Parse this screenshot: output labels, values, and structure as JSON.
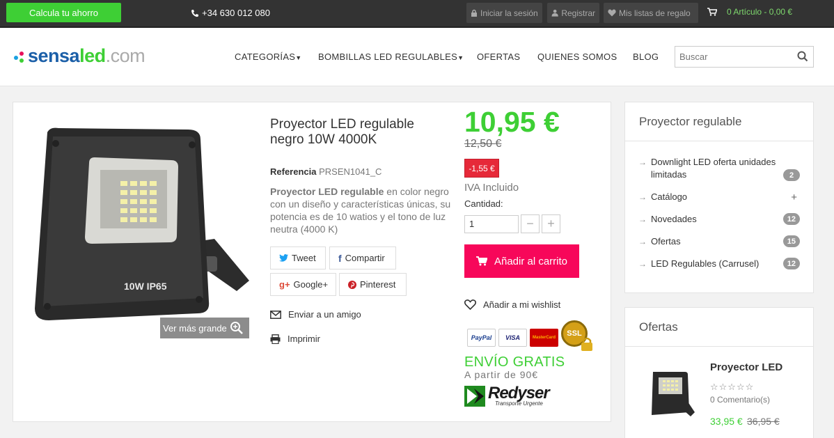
{
  "topbar": {
    "cta_label": "Calcula tu ahorro",
    "phone": "+34 630 012 080",
    "login": "Iniciar la sesión",
    "register": "Registrar",
    "gift_lists": "Mis listas de regalo",
    "cart_summary": "0 Artículo - 0,00 €"
  },
  "logo": {
    "sensa": "sensa",
    "led": "led",
    "dotcom": ".com"
  },
  "nav": {
    "items": [
      "CATEGORÍAS",
      "BOMBILLAS LED REGULABLES",
      "OFERTAS",
      "QUIENES SOMOS",
      "BLOG"
    ]
  },
  "search": {
    "placeholder": "Buscar"
  },
  "product": {
    "title": "Proyector LED regulable negro 10W 4000K",
    "reference_label": "Referencia",
    "reference": "PRSEN1041_C",
    "desc_bold": "Proyector LED regulable",
    "desc_rest": " en color negro con un diseño y características únicas, su potencia es de 10 watios y el tono de luz neutra (4000 K)",
    "zoom_label": "Ver más grande",
    "image_label": "10W  IP65",
    "share": {
      "tweet": "Tweet",
      "facebook": "Compartir",
      "google": "Google+",
      "pinterest": "Pinterest"
    },
    "send_friend": "Enviar a un amigo",
    "print": "Imprimir",
    "price": "10,95 €",
    "old_price": "12,50 €",
    "discount": "-1,55 €",
    "tax_note": "IVA Incluido",
    "quantity_label": "Cantidad:",
    "quantity_value": "1",
    "add_to_cart": "Añadir al carrito",
    "wishlist": "Añadir a mi wishlist",
    "payment": {
      "paypal": "PayPal",
      "visa": "VISA",
      "mastercard": "MasterCard",
      "ssl": "SSL"
    },
    "shipping_title": "ENVÍO GRATIS",
    "shipping_min": "A partir de 90€",
    "carrier_name": "Redyser",
    "carrier_sub": "Transporte Urgente"
  },
  "sidebar": {
    "category_title": "Proyector regulable",
    "items": [
      {
        "label": "Downlight LED oferta unidades limitadas",
        "count": "2"
      },
      {
        "label": "Catálogo",
        "count": "+"
      },
      {
        "label": "Novedades",
        "count": "12"
      },
      {
        "label": "Ofertas",
        "count": "15"
      },
      {
        "label": "LED Regulables (Carrusel)",
        "count": "12"
      }
    ],
    "offers_title": "Ofertas",
    "offer": {
      "name": "Proyector LED",
      "stars": "☆☆☆☆☆",
      "comments": "0 Comentario(s)",
      "price": "33,95 €",
      "old_price": "36,95 €"
    }
  },
  "colors": {
    "accent_green": "#3ecf35",
    "cart_pink": "#f7075a",
    "discount_red": "#e62939",
    "topbar": "#333333"
  }
}
